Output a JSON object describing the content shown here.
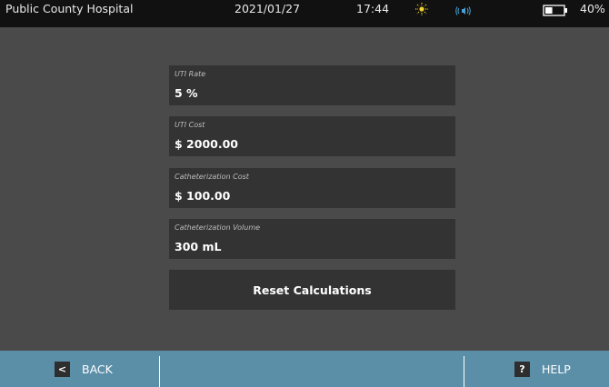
{
  "status_bar": {
    "facility": "Public County Hospital",
    "date": "2021/01/27",
    "time": "17:44",
    "battery_percent": "40%",
    "battery_level": 0.4,
    "sun_icon": "brightness-icon",
    "speaker_icon": "volume-icon",
    "colors": {
      "sun": "#f2d02e",
      "speaker": "#4aa3d8",
      "background": "#111111"
    }
  },
  "fields": [
    {
      "label": "UTI Rate",
      "value": "5 %"
    },
    {
      "label": "UTI Cost",
      "value": "$ 2000.00"
    },
    {
      "label": "Catheterization Cost",
      "value": "$ 100.00"
    },
    {
      "label": "Catheterization Volume",
      "value": "300 mL"
    }
  ],
  "reset_button": {
    "label": "Reset Calculations"
  },
  "bottom_bar": {
    "back": {
      "icon_glyph": "<",
      "label": "BACK"
    },
    "help": {
      "icon_glyph": "?",
      "label": "HELP"
    },
    "colors": {
      "background": "#5b8fa8"
    }
  }
}
